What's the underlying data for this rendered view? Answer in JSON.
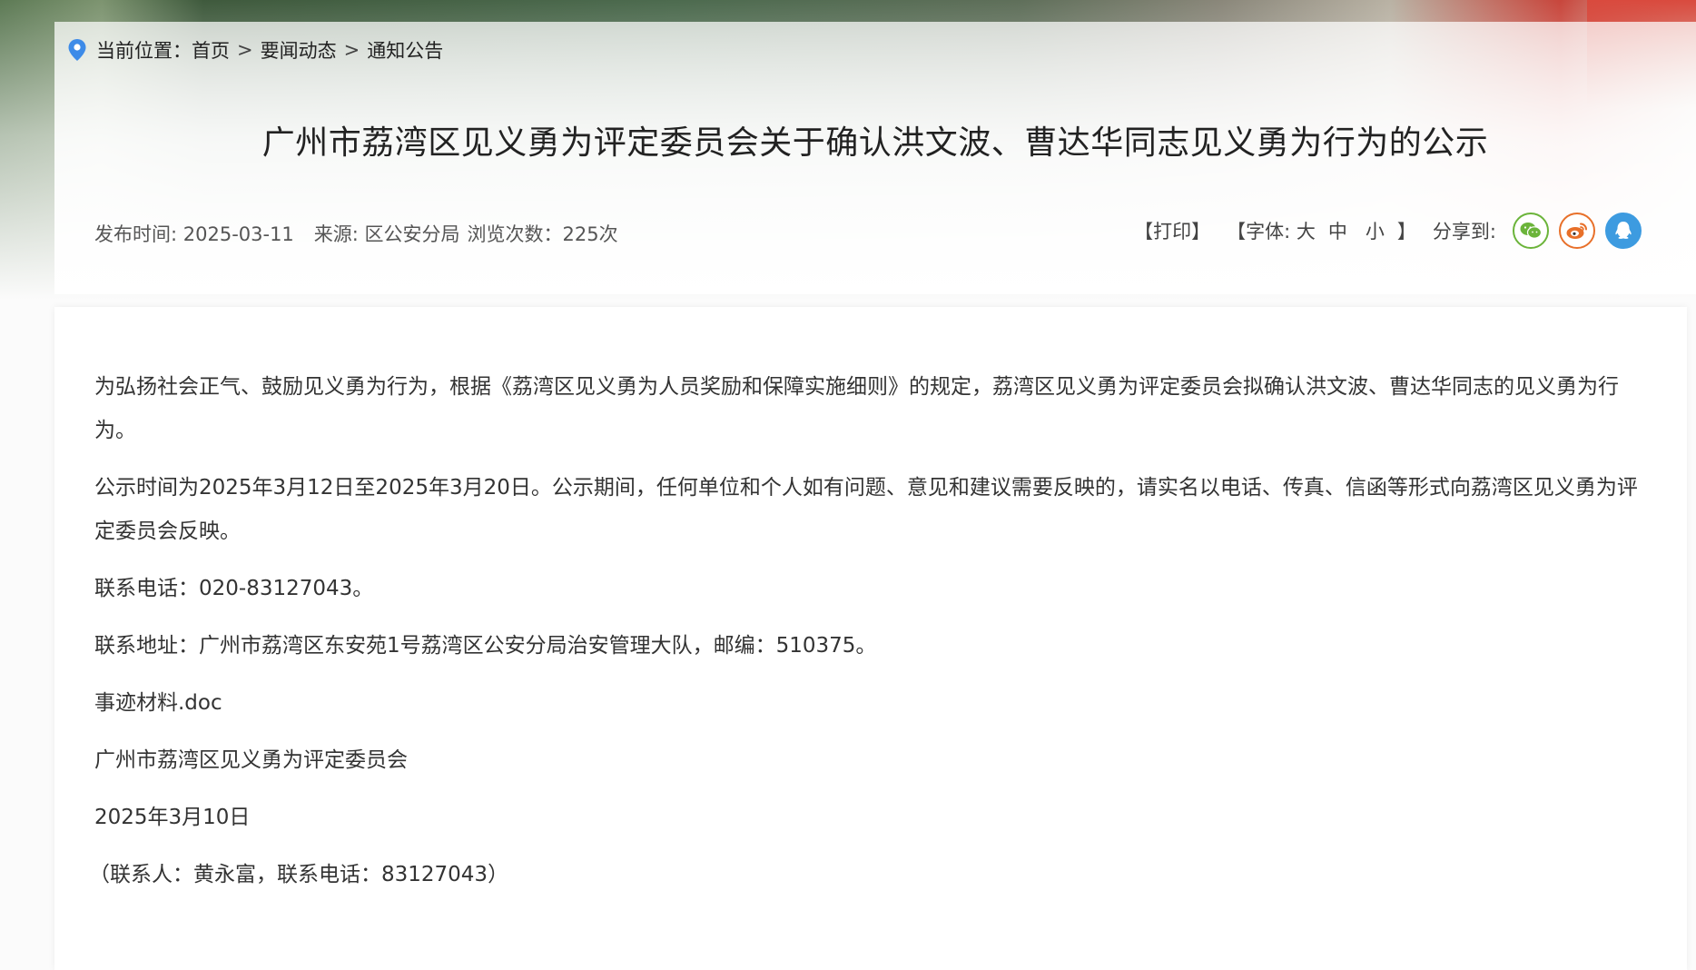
{
  "breadcrumb": {
    "label": "当前位置：",
    "items": [
      "首页",
      "要闻动态",
      "通知公告"
    ],
    "separator": ">"
  },
  "article": {
    "title": "广州市荔湾区见义勇为评定委员会关于确认洪文波、曹达华同志见义勇为行为的公示",
    "publish_time": "发布时间: 2025-03-11",
    "source": "来源: 区公安分局",
    "views": "浏览次数：225次"
  },
  "tools": {
    "print": "【打印】",
    "font_prefix": "【字体: 大",
    "font_medium": "中",
    "font_small": "小",
    "font_suffix": "】",
    "share_label": "分享到:"
  },
  "share": [
    {
      "name": "wechat",
      "icon": "wechat-icon",
      "color": "#6bb43a"
    },
    {
      "name": "weibo",
      "icon": "weibo-icon",
      "color": "#e8702a"
    },
    {
      "name": "qq",
      "icon": "qq-icon",
      "color": "#3d9be0"
    }
  ],
  "body": {
    "p1": "为弘扬社会正气、鼓励见义勇为行为，根据《荔湾区见义勇为人员奖励和保障实施细则》的规定，荔湾区见义勇为评定委员会拟确认洪文波、曹达华同志的见义勇为行为。",
    "p2": "公示时间为2025年3月12日至2025年3月20日。公示期间，任何单位和个人如有问题、意见和建议需要反映的，请实名以电话、传真、信函等形式向荔湾区见义勇为评定委员会反映。",
    "phone": "联系电话：020-83127043。",
    "address": "联系地址：广州市荔湾区东安苑1号荔湾区公安分局治安管理大队，邮编：510375。",
    "attachment": "事迹材料.doc",
    "signature": "广州市荔湾区见义勇为评定委员会",
    "date": "2025年3月10日",
    "contact": "（联系人：黄永富，联系电话：83127043）"
  },
  "colors": {
    "pin": "#3d8be8",
    "text": "#333333"
  }
}
